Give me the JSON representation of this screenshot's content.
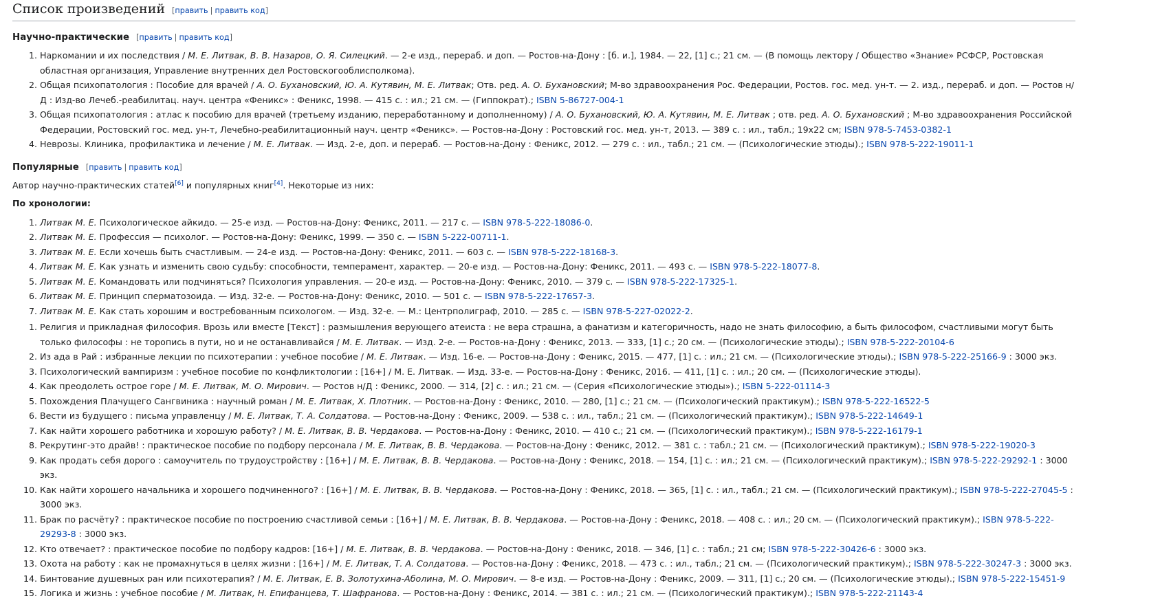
{
  "heading": {
    "title": "Список произведений",
    "edit": "править",
    "edit_code": "править код"
  },
  "section1": {
    "title": "Научно-практические",
    "edit": "править",
    "edit_code": "править код",
    "items": [
      {
        "pre": "Наркомании и их последствия / ",
        "auth": "М. Е. Литвак, В. В. Назаров, О. Я. Силецкий",
        "post": ". — 2-е изд., перераб. и доп. — Ростов-на-Дону : [б. и.], 1984. — 22, [1] с.; 21 см. — (В помощь лектору / Общество «Знание» РСФСР, Ростовская областная организация, Управление внутренних дел Ростовскогооблисполкома).",
        "isbn": "",
        "tail": ""
      },
      {
        "pre": "Общая психопатология : Пособие для врачей / ",
        "auth": "А. О. Бухановский, Ю. А. Кутявин, М. Е. Литвак",
        "post": "; Отв. ред. ",
        "auth2": "А. О. Бухановский",
        "post2": "; М-во здравоохранения Рос. Федерации, Ростов. гос. мед. ун-т. — 2. изд., перераб. и доп. — Ростов н/Д : Изд-во Лечеб.-реабилитац. науч. центра «Феникс» : Феникс, 1998. — 415 с. : ил.; 21 см. — (Гиппократ).; ",
        "isbn": "ISBN 5-86727-004-1",
        "tail": ""
      },
      {
        "pre": "Общая психопатология : атлас к пособию для врачей (третьему изданию, переработанному и дополненному) / ",
        "auth": "А. О. Бухановский, Ю. А. Кутявин, М. Е. Литвак",
        "post": " ; отв. ред. ",
        "auth2": "А. О. Бухановский",
        "post2": " ; М-во здравоохранения Российской Федерации, Ростовский гос. мед. ун-т, Лечебно-реабилитационный науч. центр «Феникс». — Ростов-на-Дону : Ростовский гос. мед. ун-т, 2013. — 389 с. : ил., табл.; 19x22 см; ",
        "isbn": "ISBN 978-5-7453-0382-1",
        "tail": ""
      },
      {
        "pre": "Неврозы. Клиника, профилактика и лечение / ",
        "auth": "М. Е. Литвак",
        "post": ". — Изд. 2-е, доп. и перераб. — Ростов-на-Дону : Феникс, 2012. — 279 с. : ил., табл.; 21 см. — (Психологические этюды).; ",
        "isbn": "ISBN 978-5-222-19011-1",
        "tail": ""
      }
    ]
  },
  "section2": {
    "title": "Популярные",
    "edit": "править",
    "edit_code": "править код",
    "intro_a": "Автор научно-практических статей",
    "ref1": "[6]",
    "intro_b": " и популярных книг",
    "ref2": "[4]",
    "intro_c": ". Некоторые из них:",
    "subhead": "По хронологии:",
    "chron": [
      {
        "auth": "Литвак М. Е.",
        "text": " Психологическое айкидо. — 25-е изд. — Ростов-на-Дону: Феникс, 2011. — 217 с. — ",
        "isbn": "ISBN 978-5-222-18086-0",
        "tail": "."
      },
      {
        "auth": "Литвак М. Е.",
        "text": " Профессия — психолог. — Ростов-на-Дону: Феникс, 1999. — 350 с. — ",
        "isbn": "ISBN 5-222-00711-1",
        "tail": "."
      },
      {
        "auth": "Литвак М. Е.",
        "text": " Если хочешь быть счастливым. — 24-е изд. — Ростов-на-Дону: Феникс, 2011. — 603 с. — ",
        "isbn": "ISBN 978-5-222-18168-3",
        "tail": "."
      },
      {
        "auth": "Литвак М. Е.",
        "text": " Как узнать и изменить свою судьбу: способности, темперамент, характер. — 20-е изд. — Ростов-на-Дону: Феникс, 2011. — 493 с. — ",
        "isbn": "ISBN 978-5-222-18077-8",
        "tail": "."
      },
      {
        "auth": "Литвак М. Е.",
        "text": " Командовать или подчиняться? Психология управления. — 20-е изд. — Ростов-на-Дону: Феникс, 2010. — 379 с. — ",
        "isbn": "ISBN 978-5-222-17325-1",
        "tail": "."
      },
      {
        "auth": "Литвак М. Е.",
        "text": " Принцип сперматозоида. — Изд. 32-е. — Ростов-на-Дону: Феникс, 2010. — 501 с. — ",
        "isbn": "ISBN 978-5-222-17657-3",
        "tail": "."
      },
      {
        "auth": "Литвак М. Е.",
        "text": " Как стать хорошим и востребованным психологом. — Изд. 32-е. — М.: Центрполиграф, 2010. — 285 с. — ",
        "isbn": "ISBN 978-5-227-02022-2",
        "tail": "."
      }
    ],
    "books": [
      {
        "pre": "Религия и прикладная философия. Врозь или вместе [Текст] : размышления верующего атеиста : не вера страшна, а фанатизм и категоричность, надо не знать философию, а быть философом, счастливыми могут быть только философы : не торопись в пути, но и не останавливайся / ",
        "auth": "М. Е. Литвак",
        "post": ". — Изд. 2-е. — Ростов-на-Дону : Феникс, 2013. — 333, [1] с.; 20 см. — (Психологические этюды).; ",
        "isbn": "ISBN 978-5-222-20104-6",
        "tail": ""
      },
      {
        "pre": "Из ада в Рай : избранные лекции по психотерапии : учебное пособие / ",
        "auth": "М. Е. Литвак",
        "post": ". — Изд. 16-е. — Ростов-на-Дону : Феникс, 2015. — 477, [1] с. : ил.; 21 см. — (Психологические этюды).; ",
        "isbn": "ISBN 978-5-222-25166-9",
        "tail": " : 3000 экз."
      },
      {
        "pre": "Психологический вампиризм : учебное пособие по конфликтологии : [16+] / М. Е. Литвак. — Изд. 33-е. — Ростов-на-Дону : Феникс, 2016. — 411, [1] с. : ил.; 20 см. — (Психологические этюды).",
        "auth": "",
        "post": "",
        "isbn": "",
        "tail": ""
      },
      {
        "pre": "Как преодолеть острое горе / ",
        "auth": "М. Е. Литвак, М. О. Мирович",
        "post": ". — Ростов н/Д : Феникс, 2000. — 314, [2] с. : ил.; 21 см. — (Серия «Психологические этюды»).; ",
        "isbn": "ISBN 5-222-01114-3",
        "tail": ""
      },
      {
        "pre": "Похождения Плачущего Сангвиника : научный роман / ",
        "auth": "М. Е. Литвак, Х. Плотник",
        "post": ". — Ростов-на-Дону : Феникс, 2010. — 280, [1] с.; 21 см. — (Психологический практикум).; ",
        "isbn": "ISBN 978-5-222-16522-5",
        "tail": ""
      },
      {
        "pre": "Вести из будущего : письма управленцу / ",
        "auth": "М. Е. Литвак, Т. А. Солдатова",
        "post": ". — Ростов-на-Дону : Феникс, 2009. — 538 с. : ил., табл.; 21 см. — (Психологический практикум).; ",
        "isbn": "ISBN 978-5-222-14649-1",
        "tail": ""
      },
      {
        "pre": "Как найти хорошего работника и хорошую работу? / ",
        "auth": "М. Е. Литвак, В. В. Чердакова",
        "post": ". — Ростов-на-Дону : Феникс, 2010. — 410 с.; 21 см. — (Психологический практикум).; ",
        "isbn": "ISBN 978-5-222-16179-1",
        "tail": ""
      },
      {
        "pre": "Рекрутинг-это драйв! : практическое пособие по подбору персонала / ",
        "auth": "М. Е. Литвак, В. В. Чердакова",
        "post": ". — Ростов-на-Дону : Феникс, 2012. — 381 с. : табл.; 21 см. — (Психологический практикум).; ",
        "isbn": "ISBN 978-5-222-19020-3",
        "tail": ""
      },
      {
        "pre": "Как продать себя дорого : самоучитель по трудоустройству : [16+] / ",
        "auth": "М. Е. Литвак, В. В. Чердакова",
        "post": ". — Ростов-на-Дону : Феникс, 2018. — 154, [1] с. : ил.; 21 см. — (Психологический практикум).; ",
        "isbn": "ISBN 978-5-222-29292-1",
        "tail": " : 3000 экз."
      },
      {
        "pre": "Как найти хорошего начальника и хорошего подчиненного? : [16+] / ",
        "auth": "М. Е. Литвак, В. В. Чердакова",
        "post": ". — Ростов-на-Дону : Феникс, 2018. — 365, [1] с. : ил., табл.; 21 см. — (Психологический практикум).; ",
        "isbn": "ISBN 978-5-222-27045-5",
        "tail": " : 3000 экз."
      },
      {
        "pre": "Брак по расчёту? : практическое пособие по построению счастливой семьи : [16+] / ",
        "auth": "М. Е. Литвак, В. В. Чердакова",
        "post": ". — Ростов-на-Дону : Феникс, 2018. — 408 с. : ил.; 20 см. — (Психологический практикум).; ",
        "isbn": "ISBN 978-5-222-29293-8",
        "tail": " : 3000 экз."
      },
      {
        "pre": "Кто отвечает? : практическое пособие по подбору кадров: [16+] / ",
        "auth": "М. Е. Литвак, В. В. Чердакова",
        "post": ". — Ростов-на-Дону : Феникс, 2018. — 346, [1] с. : табл.; 21 см; ",
        "isbn": "ISBN 978-5-222-30426-6",
        "tail": " : 3000 экз."
      },
      {
        "pre": "Охота на работу : как не промахнуться в целях жизни : [16+] / ",
        "auth": "М. Е. Литвак, Т. А. Солдатова",
        "post": ". — Ростов-на-Дону : Феникс, 2018. — 473 с. : ил., табл.; 21 см. — (Психологический практикум).; ",
        "isbn": "ISBN 978-5-222-30247-3",
        "tail": " : 3000 экз."
      },
      {
        "pre": "Бинтование душевных ран или психотерапия? / ",
        "auth": "М. Е. Литвак, Е. В. Золотухина-Аболина, М. О. Мирович",
        "post": ". — 8-е изд. — Ростов-на-Дону : Феникс, 2009. — 311, [1] с.; 20 см. — (Психологические этюды).; ",
        "isbn": "ISBN 978-5-222-15451-9",
        "tail": ""
      },
      {
        "pre": "Логика и жизнь : учебное пособие / ",
        "auth": "М. Литвак, Н. Епифанцева, Т. Шафранова",
        "post": ". — Ростов-на-Дону : Феникс, 2014. — 381 с. : ил.; 21 см. — (Психологический практикум).; ",
        "isbn": "ISBN 978-5-222-21143-4",
        "tail": ""
      }
    ]
  }
}
